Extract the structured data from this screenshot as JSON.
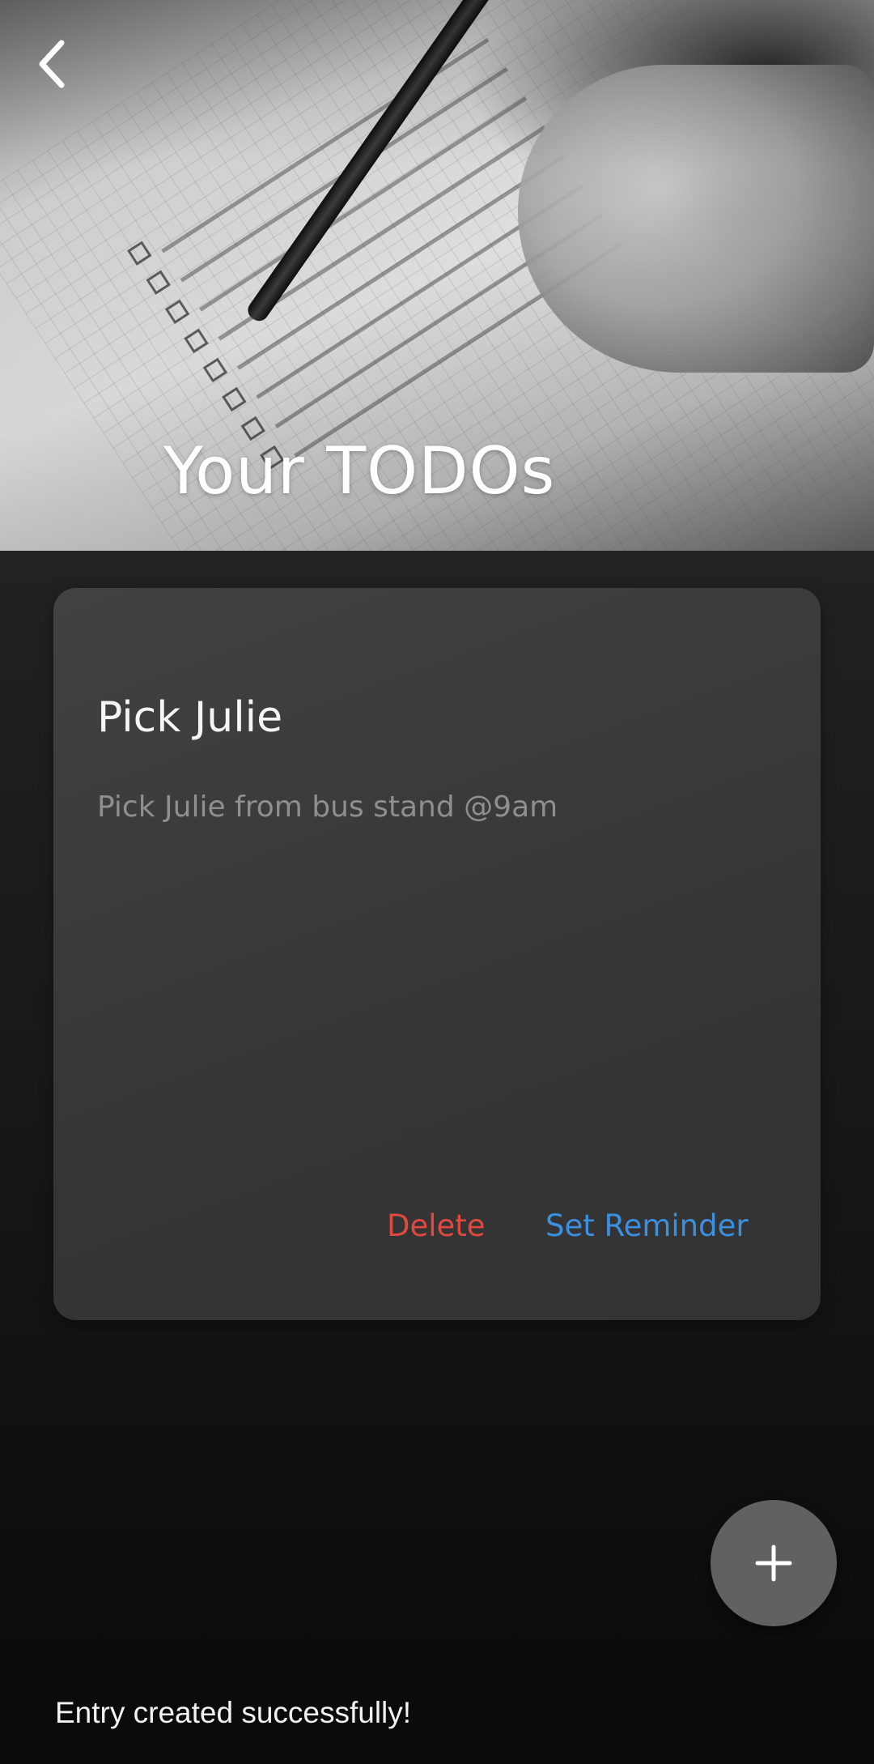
{
  "header": {
    "title": "Your TODOs",
    "back_icon": "chevron-left-icon"
  },
  "todos": [
    {
      "title": "Pick Julie",
      "description": "Pick Julie from bus stand @9am",
      "delete_label": "Delete",
      "reminder_label": "Set Reminder"
    }
  ],
  "fab": {
    "icon": "plus-icon"
  },
  "snackbar": {
    "message": "Entry created successfully!"
  },
  "colors": {
    "delete": "#e0493f",
    "reminder": "#3d8fe0",
    "card": "#3a3a3a",
    "fab": "#616161"
  }
}
